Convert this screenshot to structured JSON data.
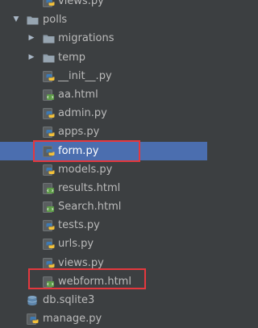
{
  "tree": {
    "items": [
      {
        "label": "views.py",
        "kind": "py",
        "depth": 2,
        "arrow": ""
      },
      {
        "label": "polls",
        "kind": "folder",
        "depth": 1,
        "arrow": "down"
      },
      {
        "label": "migrations",
        "kind": "folder",
        "depth": 2,
        "arrow": "right"
      },
      {
        "label": "temp",
        "kind": "folder",
        "depth": 2,
        "arrow": "right"
      },
      {
        "label": "__init__.py",
        "kind": "py",
        "depth": 2,
        "arrow": ""
      },
      {
        "label": "aa.html",
        "kind": "html",
        "depth": 2,
        "arrow": ""
      },
      {
        "label": "admin.py",
        "kind": "py",
        "depth": 2,
        "arrow": ""
      },
      {
        "label": "apps.py",
        "kind": "py",
        "depth": 2,
        "arrow": ""
      },
      {
        "label": "form.py",
        "kind": "py",
        "depth": 2,
        "arrow": "",
        "selected": true,
        "highlighted": true
      },
      {
        "label": "models.py",
        "kind": "py",
        "depth": 2,
        "arrow": ""
      },
      {
        "label": "results.html",
        "kind": "html",
        "depth": 2,
        "arrow": ""
      },
      {
        "label": "Search.html",
        "kind": "html",
        "depth": 2,
        "arrow": ""
      },
      {
        "label": "tests.py",
        "kind": "py",
        "depth": 2,
        "arrow": ""
      },
      {
        "label": "urls.py",
        "kind": "py",
        "depth": 2,
        "arrow": ""
      },
      {
        "label": "views.py",
        "kind": "py",
        "depth": 2,
        "arrow": ""
      },
      {
        "label": "webform.html",
        "kind": "html",
        "depth": 2,
        "arrow": "",
        "highlighted": true
      },
      {
        "label": "db.sqlite3",
        "kind": "db",
        "depth": 1,
        "arrow": ""
      },
      {
        "label": "manage.py",
        "kind": "py",
        "depth": 1,
        "arrow": ""
      }
    ]
  },
  "colors": {
    "background": "#3c3f41",
    "selection": "#4b6eaf",
    "highlight_box": "#e4383e",
    "text": "#bbbbbb",
    "folder": "#8b9aa7",
    "python_blue": "#3d7ab4",
    "python_yellow": "#f3c13a",
    "html_green": "#5d9b47"
  },
  "icons": {
    "folder": "folder-icon",
    "py": "python-file-icon",
    "html": "html-file-icon",
    "db": "database-icon"
  }
}
